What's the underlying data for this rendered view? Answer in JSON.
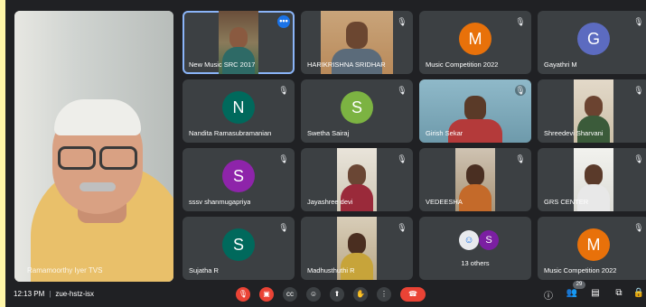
{
  "presenter": {
    "name": "Ramamoorthy Iyer TVS"
  },
  "tiles": [
    {
      "id": "t1",
      "name": "New Music SRC 2017",
      "kind": "video",
      "active": true,
      "more": "•••"
    },
    {
      "id": "t2",
      "name": "HARIKRISHNA SRIDHAR",
      "kind": "video"
    },
    {
      "id": "t3",
      "name": "Music Competition 2022",
      "kind": "avatar",
      "initial": "M",
      "color": "#e8710a"
    },
    {
      "id": "t4",
      "name": "Gayathri M",
      "kind": "avatar",
      "initial": "G",
      "color": "#5c6bc0"
    },
    {
      "id": "t5",
      "name": "Nandita Ramasubramanian",
      "kind": "avatar",
      "initial": "N",
      "color": "#00695c"
    },
    {
      "id": "t6",
      "name": "Swetha Sairaj",
      "kind": "avatar",
      "initial": "S",
      "color": "#7cb342"
    },
    {
      "id": "t7",
      "name": "Girish Sekar",
      "kind": "video"
    },
    {
      "id": "t8",
      "name": "Shreedevi Sharvani",
      "kind": "video"
    },
    {
      "id": "t9",
      "name": "sssv shanmugapriya",
      "kind": "avatar",
      "initial": "S",
      "color": "#8e24aa"
    },
    {
      "id": "t10",
      "name": "Jayashree devi",
      "kind": "video"
    },
    {
      "id": "t11",
      "name": "VEDEESHA",
      "kind": "video"
    },
    {
      "id": "t12",
      "name": "GRS CENTER",
      "kind": "video"
    },
    {
      "id": "t13",
      "name": "Sujatha R",
      "kind": "avatar",
      "initial": "S",
      "color": "#00695c"
    },
    {
      "id": "t14",
      "name": "Madhusthuthi R",
      "kind": "video"
    },
    {
      "id": "t15",
      "name": "13 others",
      "kind": "others",
      "initial": "S",
      "color": "#7b1fa2"
    },
    {
      "id": "t16",
      "name": "Music Competition 2022",
      "kind": "avatar",
      "initial": "M",
      "color": "#e8710a"
    }
  ],
  "bottombar": {
    "time": "12:13 PM",
    "meeting_code": "zue-hstz-isx",
    "participant_count": "29"
  },
  "icons": {
    "mic_off": "mic-off-icon",
    "cam_off": "camera-off-icon",
    "captions": "captions-icon",
    "emoji": "emoji-icon",
    "present": "present-icon",
    "hand": "raise-hand-icon",
    "more": "more-options-icon",
    "hangup": "hang-up-icon",
    "info": "info-icon",
    "people": "people-icon",
    "chat": "chat-icon",
    "activities": "activities-icon",
    "lock": "host-controls-icon"
  }
}
